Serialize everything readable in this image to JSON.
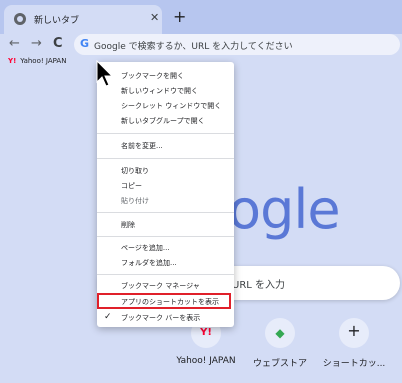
{
  "tab": {
    "title": "新しいタブ",
    "close_icon": "close-icon",
    "favicon_icon": "chrome-newtab-icon"
  },
  "newtab": {
    "label": "+"
  },
  "toolbar": {
    "back": "←",
    "forward": "→",
    "reload": "C",
    "omnibox_g": "G",
    "omnibox_text": "Google で検索するか、URL を入力してください"
  },
  "bookmarks_bar": {
    "yahoo_label": "Yahoo! JAPAN",
    "yahoo_mark": "Y!"
  },
  "ntp": {
    "logo": "oogle",
    "search_text": "URL を入力",
    "shortcuts": [
      {
        "label": "Yahoo! JAPAN",
        "glyph": "Y!",
        "color": "#ff0033"
      },
      {
        "label": "ウェブストア",
        "glyph": "◆",
        "color": "#34a853"
      },
      {
        "label": "ショートカッ...",
        "glyph": "+",
        "color": "#202124"
      }
    ]
  },
  "context_menu": {
    "items": [
      {
        "label": "ブックマークを開く",
        "enabled": true
      },
      {
        "label": "新しいウィンドウで開く",
        "enabled": true
      },
      {
        "label": "シークレット ウィンドウで開く",
        "enabled": true
      },
      {
        "label": "新しいタブグループで開く",
        "enabled": true
      },
      {
        "label": "名前を変更...",
        "enabled": true
      },
      {
        "label": "切り取り",
        "enabled": true
      },
      {
        "label": "コピー",
        "enabled": true
      },
      {
        "label": "貼り付け",
        "enabled": true
      },
      {
        "label": "削除",
        "enabled": true
      },
      {
        "label": "ページを追加...",
        "enabled": true
      },
      {
        "label": "フォルダを追加...",
        "enabled": true
      },
      {
        "label": "ブックマーク マネージャ",
        "enabled": true
      },
      {
        "label": "アプリのショートカットを表示",
        "enabled": true
      },
      {
        "label": "ブックマーク バーを表示",
        "enabled": true,
        "checked": true
      }
    ],
    "check_mark": "✓",
    "highlighted_item": "アプリのショートカットを表示",
    "highlight_color": "#e0202a"
  }
}
